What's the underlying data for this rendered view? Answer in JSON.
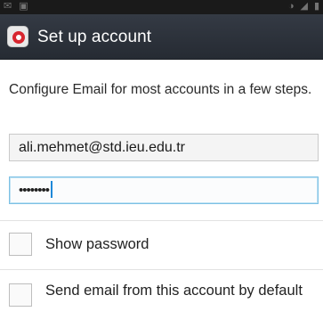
{
  "status_bar": {
    "icons": [
      "notification-icon",
      "image-icon",
      "wifi-icon",
      "signal-icon",
      "battery-icon"
    ]
  },
  "action_bar": {
    "title": "Set up account",
    "icon": "email-app-icon",
    "background_color": "#2d323a",
    "accent_color": "#d8262f"
  },
  "intro_text": "Configure Email for most accounts in a few steps.",
  "email_field": {
    "value": "ali.mehmet@std.ieu.edu.tr"
  },
  "password_field": {
    "value": "••••••••",
    "focus_color": "#7cc0e4"
  },
  "options": {
    "show_password": {
      "label": "Show password",
      "checked": false
    },
    "default_account": {
      "label": "Send email from this account by default",
      "checked": false
    }
  }
}
